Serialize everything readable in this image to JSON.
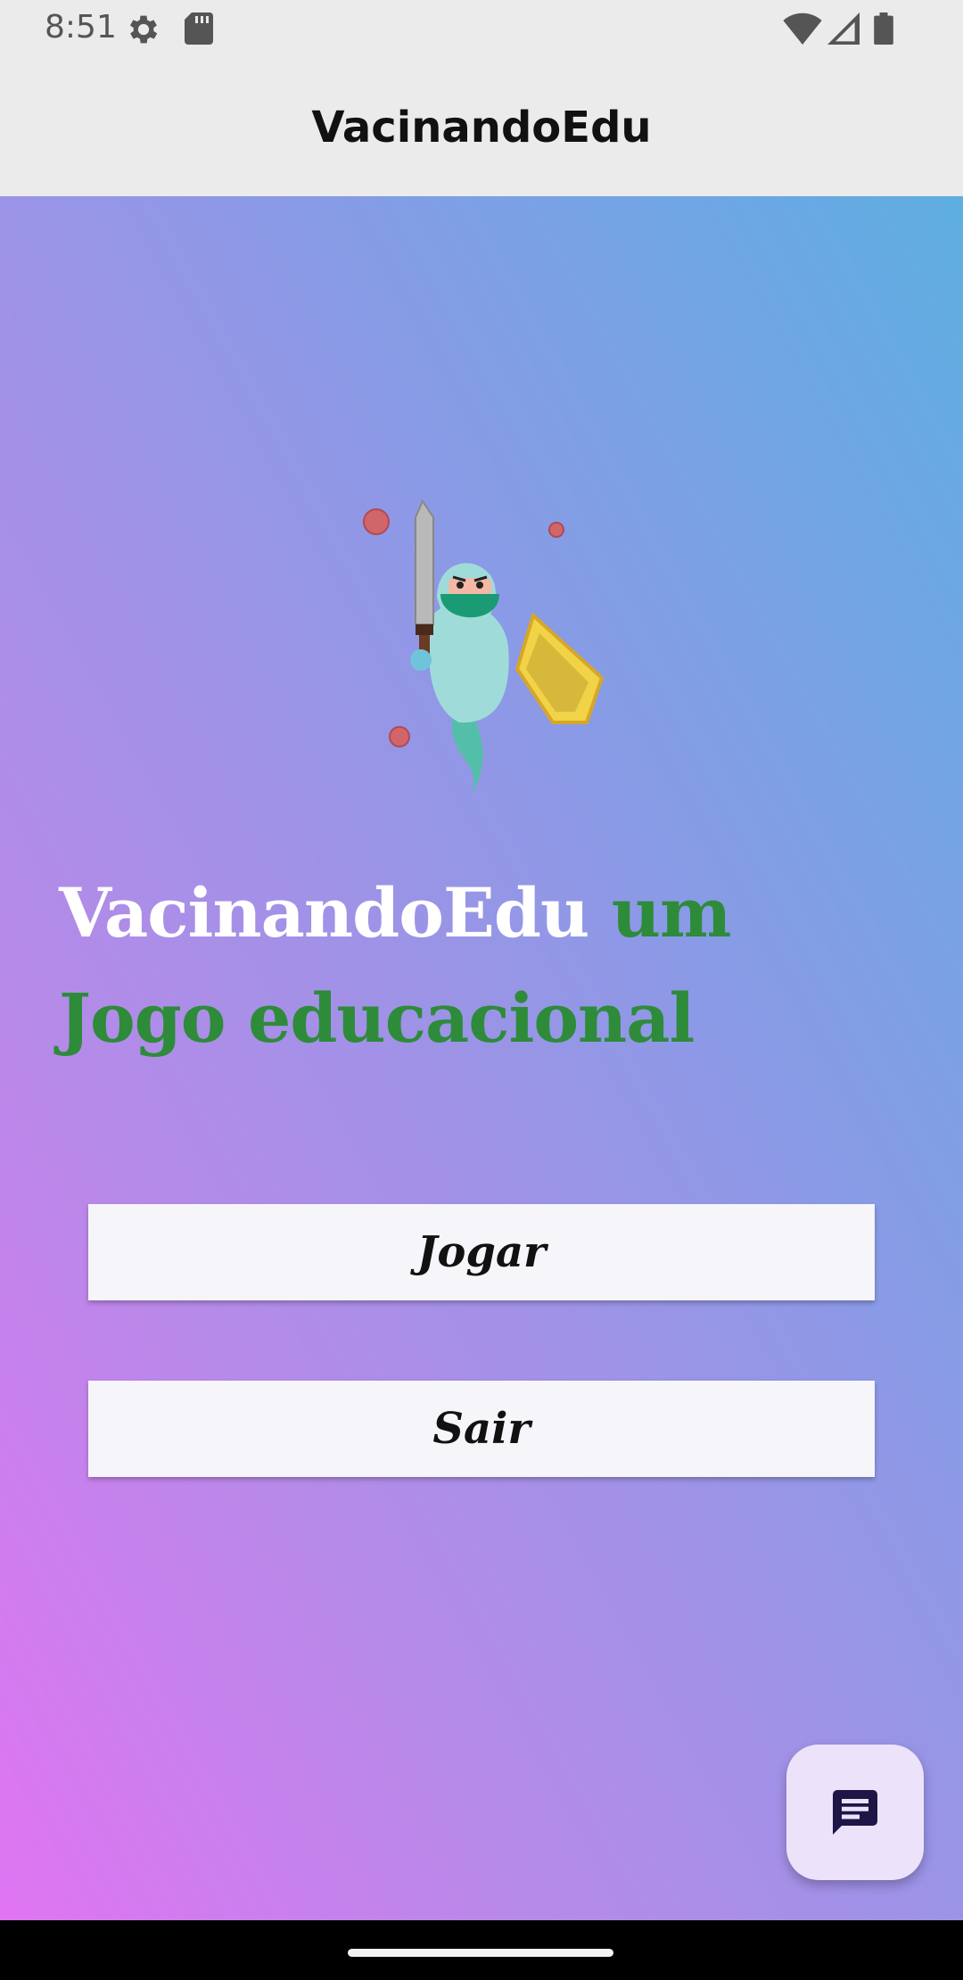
{
  "status_bar": {
    "time": "8:51"
  },
  "app_bar": {
    "title": "VacinandoEdu"
  },
  "hero": {
    "illustration": "knight-with-sword-and-shield",
    "virus_icon": "virus-icon"
  },
  "headline": {
    "brand": "VacinandoEdu",
    "rest": " um Jogo educacional"
  },
  "buttons": {
    "play": "Jogar",
    "exit": "Sair"
  },
  "fab": {
    "icon": "chat-icon"
  },
  "colors": {
    "gradient_top": "#5eaee2",
    "gradient_bottom": "#e074f2",
    "headline_green": "#2e8b3a",
    "fab_bg": "#ece3fb",
    "fab_icon": "#1f1647"
  }
}
